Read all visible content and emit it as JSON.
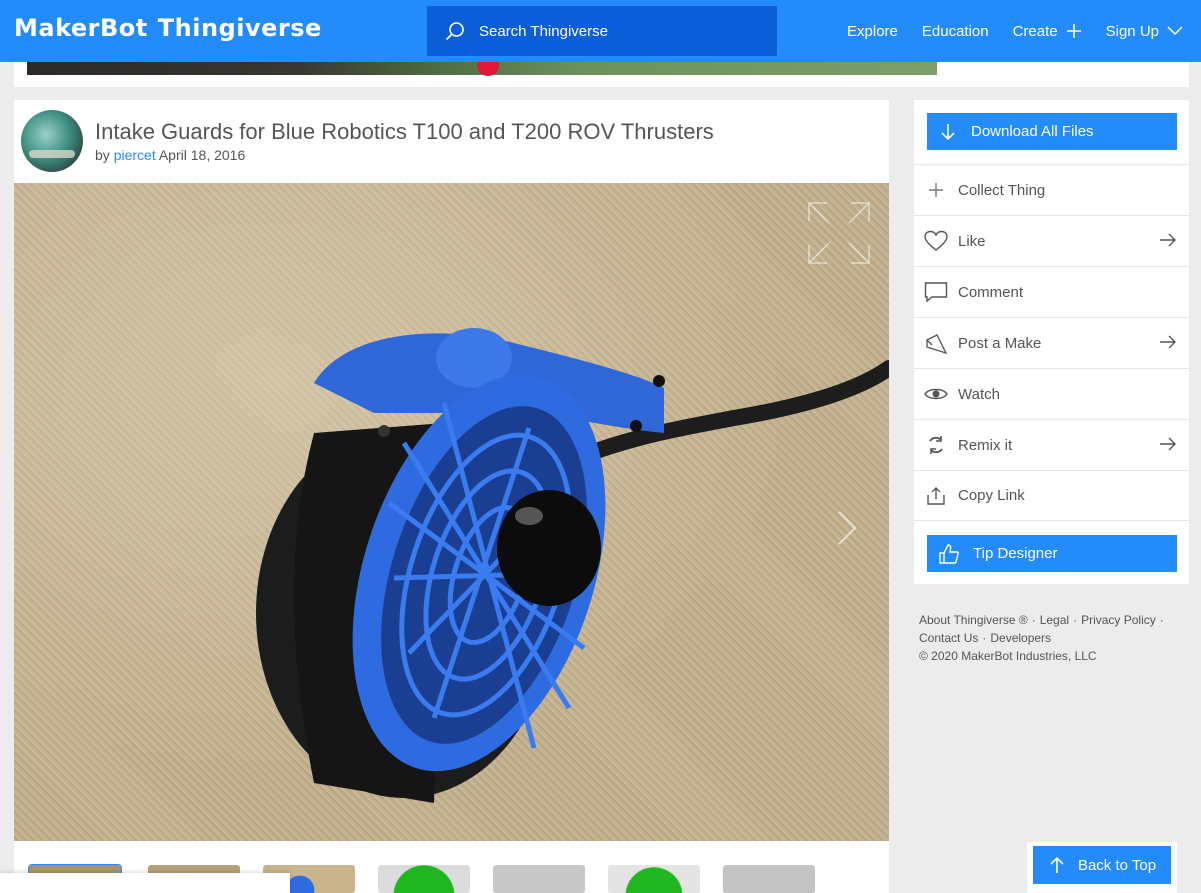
{
  "header": {
    "logo_brand": "MakerBot",
    "logo_product": "Thingiverse",
    "search_placeholder": "Search Thingiverse",
    "nav": [
      {
        "label": "Explore"
      },
      {
        "label": "Education"
      },
      {
        "label": "Create"
      },
      {
        "label": "Sign Up"
      }
    ],
    "colors": {
      "bar": "#248bfb",
      "search": "#0c5ed8"
    }
  },
  "thing": {
    "title": "Intake Guards for Blue Robotics T100 and T200 ROV Thrusters",
    "by_label": "by",
    "author": "piercet",
    "date": "April 18, 2016",
    "thumbnail_count": 7
  },
  "sidebar": {
    "download_label": "Download All Files",
    "actions": [
      {
        "label": "Collect Thing",
        "icon": "plus-icon",
        "arrow": false
      },
      {
        "label": "Like",
        "icon": "heart-icon",
        "arrow": true
      },
      {
        "label": "Comment",
        "icon": "comment-icon",
        "arrow": false
      },
      {
        "label": "Post a Make",
        "icon": "make-icon",
        "arrow": true
      },
      {
        "label": "Watch",
        "icon": "eye-icon",
        "arrow": false
      },
      {
        "label": "Remix it",
        "icon": "remix-icon",
        "arrow": true
      },
      {
        "label": "Copy Link",
        "icon": "share-icon",
        "arrow": false
      }
    ],
    "tip_label": "Tip Designer"
  },
  "footer": {
    "about": "About Thingiverse ®",
    "legal": "Legal",
    "privacy": "Privacy Policy",
    "contact": "Contact Us",
    "developers": "Developers",
    "copyright": "©  2020 MakerBot Industries, LLC"
  },
  "back_to_top_label": "Back to Top"
}
